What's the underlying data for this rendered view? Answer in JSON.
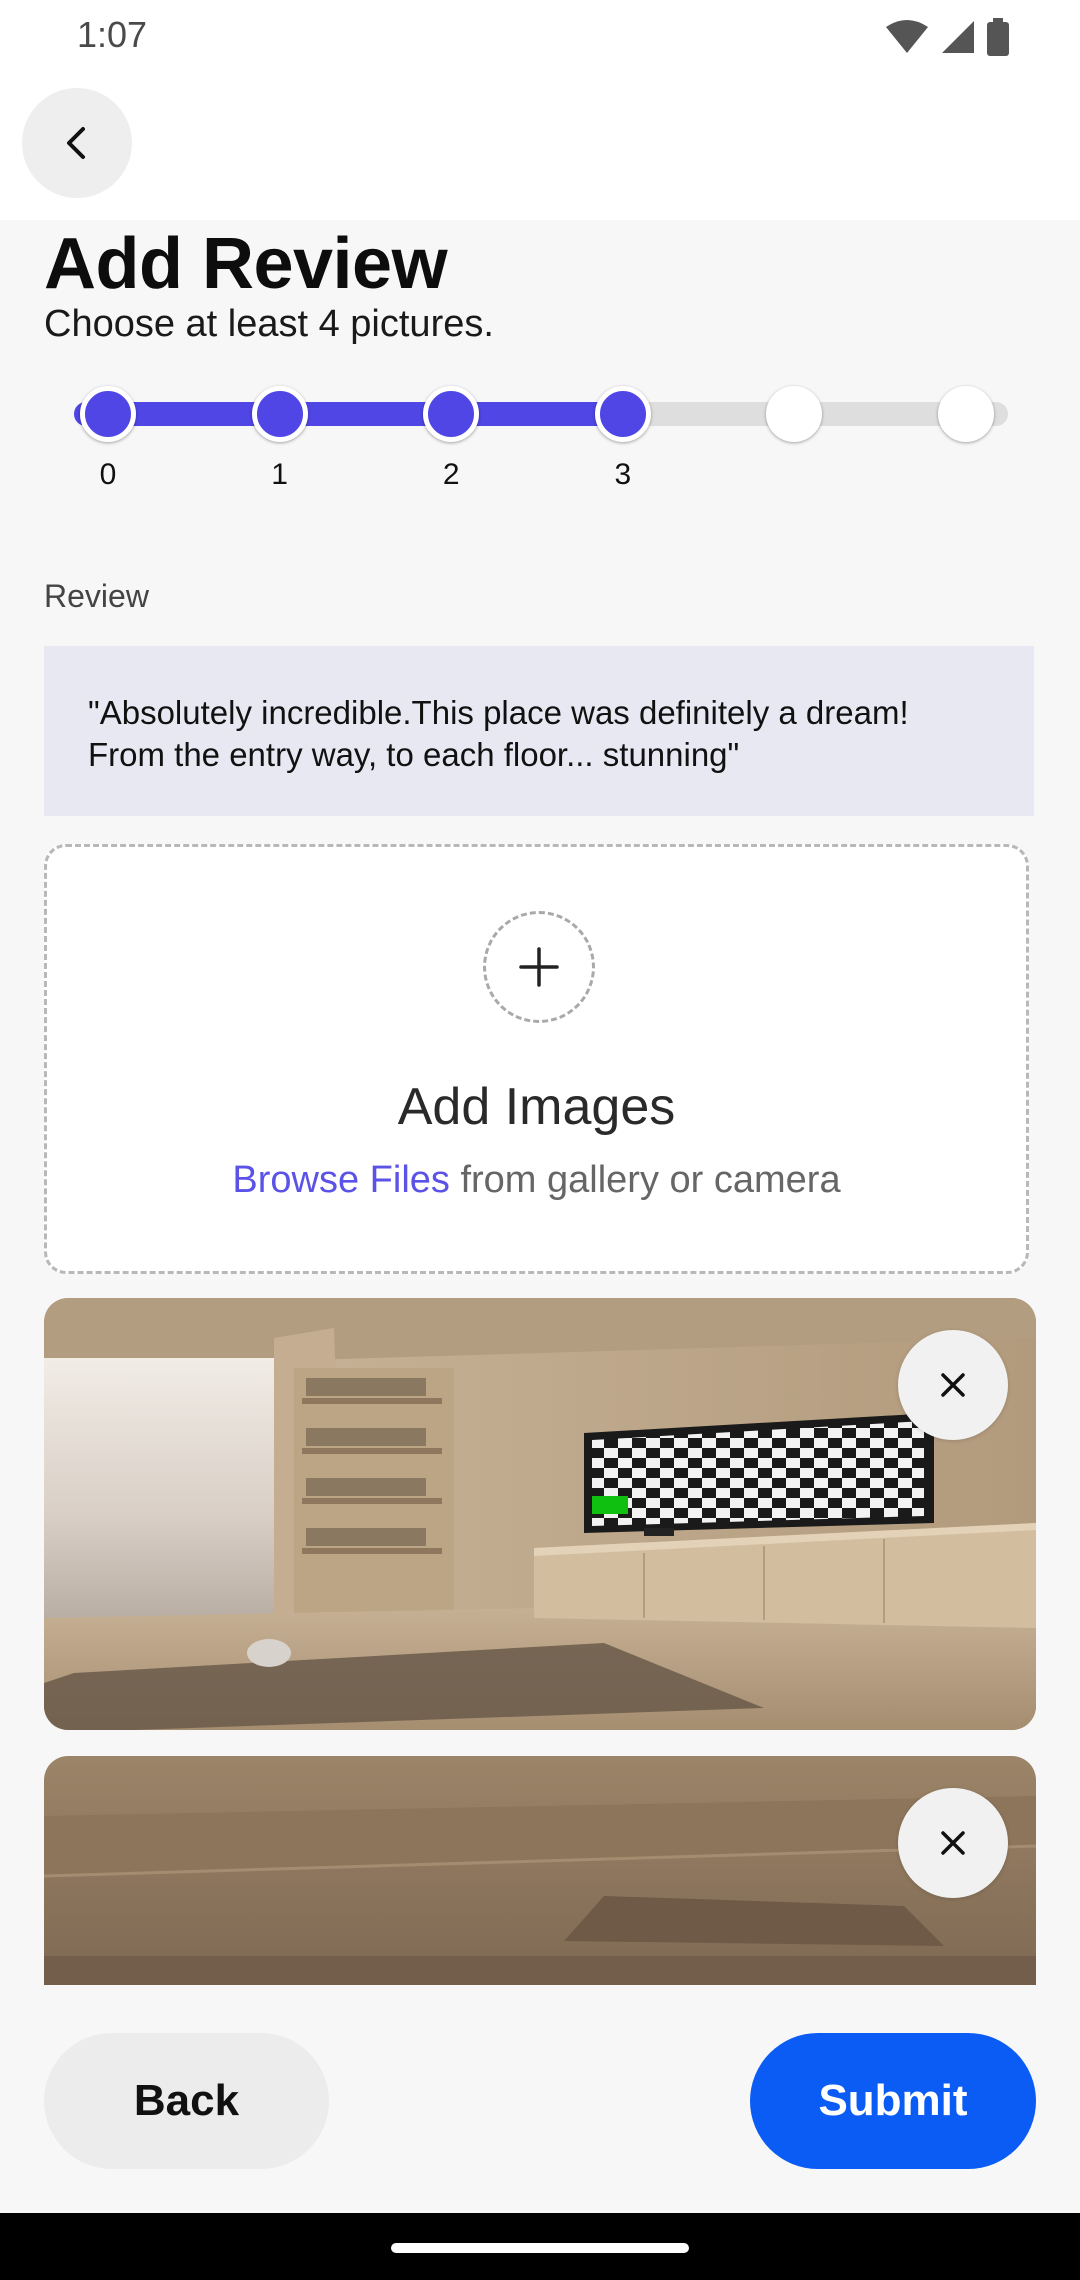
{
  "status_bar": {
    "time": "1:07",
    "icons": [
      "wifi-icon",
      "signal-icon",
      "battery-icon"
    ]
  },
  "top_bar": {
    "back_icon": "chevron-left-icon"
  },
  "header": {
    "title": "Add Review",
    "subtitle": "Choose at least 4 pictures."
  },
  "stepper": {
    "total_steps": 6,
    "completed_steps": 4,
    "labels": [
      "0",
      "1",
      "2",
      "3"
    ],
    "active_color": "#4f46e5",
    "inactive_color": "#dedede"
  },
  "review": {
    "label": "Review",
    "text": "\"Absolutely incredible.This place was definitely a dream! From the entry way, to each floor... stunning\""
  },
  "upload": {
    "plus_icon": "plus-icon",
    "title": "Add Images",
    "browse_link": "Browse Files",
    "browse_rest": " from gallery or camera"
  },
  "images": [
    {
      "name": "living-room-photo",
      "remove_icon": "close-icon"
    },
    {
      "name": "ceiling-photo",
      "remove_icon": "close-icon"
    }
  ],
  "actions": {
    "back_label": "Back",
    "submit_label": "Submit"
  },
  "colors": {
    "accent": "#4f46e5",
    "submit": "#0a5cf5",
    "link": "#5b52e8"
  }
}
